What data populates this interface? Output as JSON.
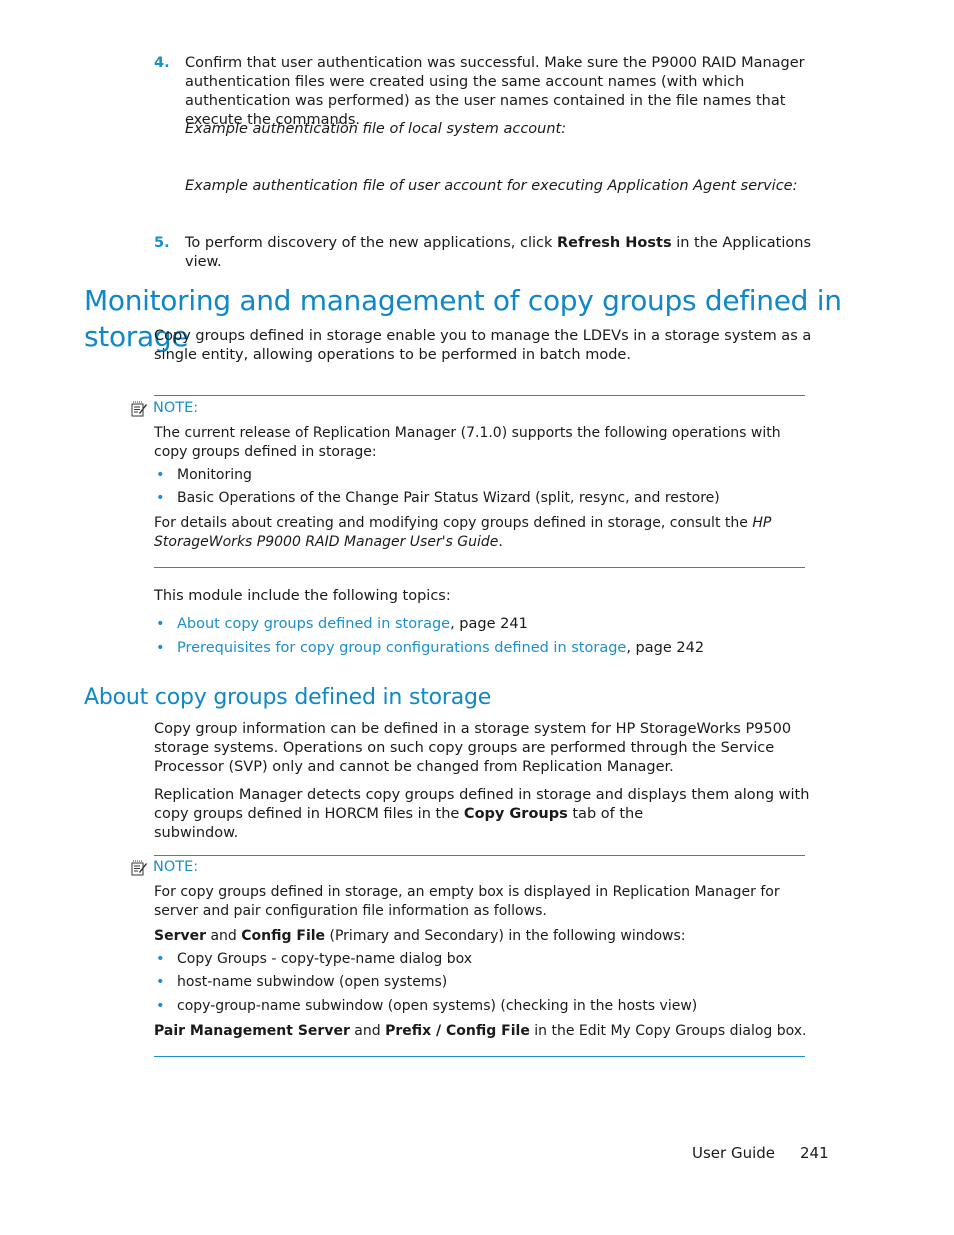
{
  "steps": [
    {
      "number": "4.",
      "text": "Confirm that user authentication was successful. Make sure the P9000 RAID Manager authentication files were created using the same account names (with which authentication was performed) as the user names contained in the file names that execute the commands.",
      "examples": [
        "Example authentication file of local system account:",
        "Example authentication file of user account for executing Application Agent service:"
      ]
    },
    {
      "number": "5.",
      "text_before": "To perform discovery of the new applications, click ",
      "bold": "Refresh Hosts",
      "text_after": " in the Applications view."
    }
  ],
  "section1": {
    "title": "Monitoring and management of copy groups defined in storage",
    "intro": "Copy groups defined in storage enable you to manage the LDEVs in a storage system as a single entity, allowing operations to be performed in batch mode.",
    "note": {
      "label": "NOTE:",
      "icon": "note-icon",
      "text": "The current release of Replication Manager (7.1.0) supports the following operations with copy groups defined in storage:",
      "bullets": [
        "Monitoring",
        "Basic Operations of the Change Pair Status Wizard (split, resync, and restore)"
      ],
      "details_before": "For details about creating and modifying copy groups defined in storage, consult the ",
      "details_italic": "HP StorageWorks P9000 RAID Manager User's Guide",
      "details_after": "."
    },
    "topics_intro": "This module include the following topics:",
    "topics": [
      {
        "link": "About copy groups defined in storage",
        "page": ", page 241"
      },
      {
        "link": "Prerequisites for copy group configurations defined in storage",
        "page": ", page 242"
      }
    ]
  },
  "section2": {
    "title": "About copy groups defined in storage",
    "para1": "Copy group information can be defined in a storage system for HP StorageWorks P9500 storage systems. Operations on such copy groups are performed through the Service Processor (SVP) only and cannot be changed from Replication Manager.",
    "para2_before": "Replication Manager detects copy groups defined in storage and displays them along with copy groups defined in HORCM files in the ",
    "para2_bold": "Copy Groups",
    "para2_mid": " tab of the ",
    "para2_after": " subwindow.",
    "note": {
      "label": "NOTE:",
      "icon": "note-icon",
      "text": "For copy groups defined in storage, an empty box is displayed in Replication Manager for server and pair configuration file information as follows.",
      "line2_bold1": "Server",
      "line2_and": " and ",
      "line2_bold2": "Config File",
      "line2_rest": " (Primary and Secondary) in the following windows:",
      "bullets": [
        "Copy Groups - copy-type-name dialog box",
        "host-name subwindow (open systems)",
        "copy-group-name subwindow (open systems) (checking in the hosts view)"
      ],
      "last_bold1": "Pair Management Server",
      "last_and": " and ",
      "last_bold2": "Prefix / Config File",
      "last_rest": " in the Edit My Copy Groups dialog box."
    }
  },
  "footer": {
    "label": "User Guide",
    "page": "241"
  },
  "colors": {
    "accent": "#1a8fcd",
    "heading": "#0f87c8",
    "text": "#1a1a1a"
  }
}
